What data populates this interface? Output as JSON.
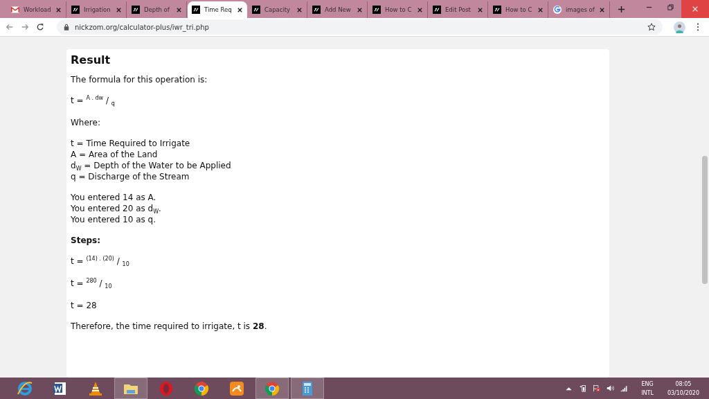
{
  "tabs": [
    {
      "title": "Workload",
      "kind": "gmail",
      "selected": false
    },
    {
      "title": "Irrigation",
      "kind": "site",
      "selected": false
    },
    {
      "title": "Depth of",
      "kind": "site",
      "selected": false
    },
    {
      "title": "Time Req",
      "kind": "site",
      "selected": true
    },
    {
      "title": "Capacity",
      "kind": "site",
      "selected": false
    },
    {
      "title": "Add New",
      "kind": "site",
      "selected": false
    },
    {
      "title": "How to C",
      "kind": "site",
      "selected": false
    },
    {
      "title": "Edit Post",
      "kind": "site",
      "selected": false
    },
    {
      "title": "How to C",
      "kind": "site",
      "selected": false
    },
    {
      "title": "images of",
      "kind": "google",
      "selected": false
    }
  ],
  "address_bar": {
    "url": "nickzom.org/calculator-plus/iwr_tri.php"
  },
  "result": {
    "heading": "Result",
    "blocks": [
      {
        "kind": "para",
        "lines": [
          "The formula for this operation is:"
        ]
      },
      {
        "kind": "formula",
        "lines": [
          "t = $^{A . dw}$ / $_{q}$"
        ]
      },
      {
        "kind": "para",
        "lines": [
          "Where:"
        ]
      },
      {
        "kind": "para",
        "lines": [
          "t = Time Required to Irrigate",
          "A = Area of the Land",
          "d$_{W}$ = Depth of the Water to be Applied",
          "q = Discharge of the Stream"
        ]
      },
      {
        "kind": "para",
        "lines": [
          "You entered 14 as A.",
          "You entered 20 as d$_{W}$.",
          "You entered 10 as q."
        ]
      },
      {
        "kind": "bold",
        "lines": [
          "Steps:"
        ]
      },
      {
        "kind": "formula",
        "lines": [
          "t = $^{(14) . (20)}$ / $_{10}$"
        ]
      },
      {
        "kind": "formula",
        "lines": [
          "t = $^{280}$ / $_{10}$"
        ]
      },
      {
        "kind": "para",
        "lines": [
          "t = 28"
        ]
      },
      {
        "kind": "para",
        "lines": [
          "Therefore, the time required to irrigate, t is **28**."
        ]
      }
    ]
  },
  "taskbar": {
    "apps": [
      {
        "kind": "ie",
        "highlighted": false
      },
      {
        "kind": "word",
        "highlighted": false
      },
      {
        "kind": "vlc",
        "highlighted": false
      },
      {
        "kind": "explorer",
        "highlighted": true
      },
      {
        "kind": "opera",
        "highlighted": false
      },
      {
        "kind": "chrome",
        "highlighted": false
      },
      {
        "kind": "uc",
        "highlighted": false
      },
      {
        "kind": "chrome",
        "highlighted": true
      },
      {
        "kind": "calculator",
        "highlighted": true
      }
    ],
    "language": "ENG",
    "layout": "INTL",
    "time": "08:05",
    "date": "03/10/2020"
  }
}
